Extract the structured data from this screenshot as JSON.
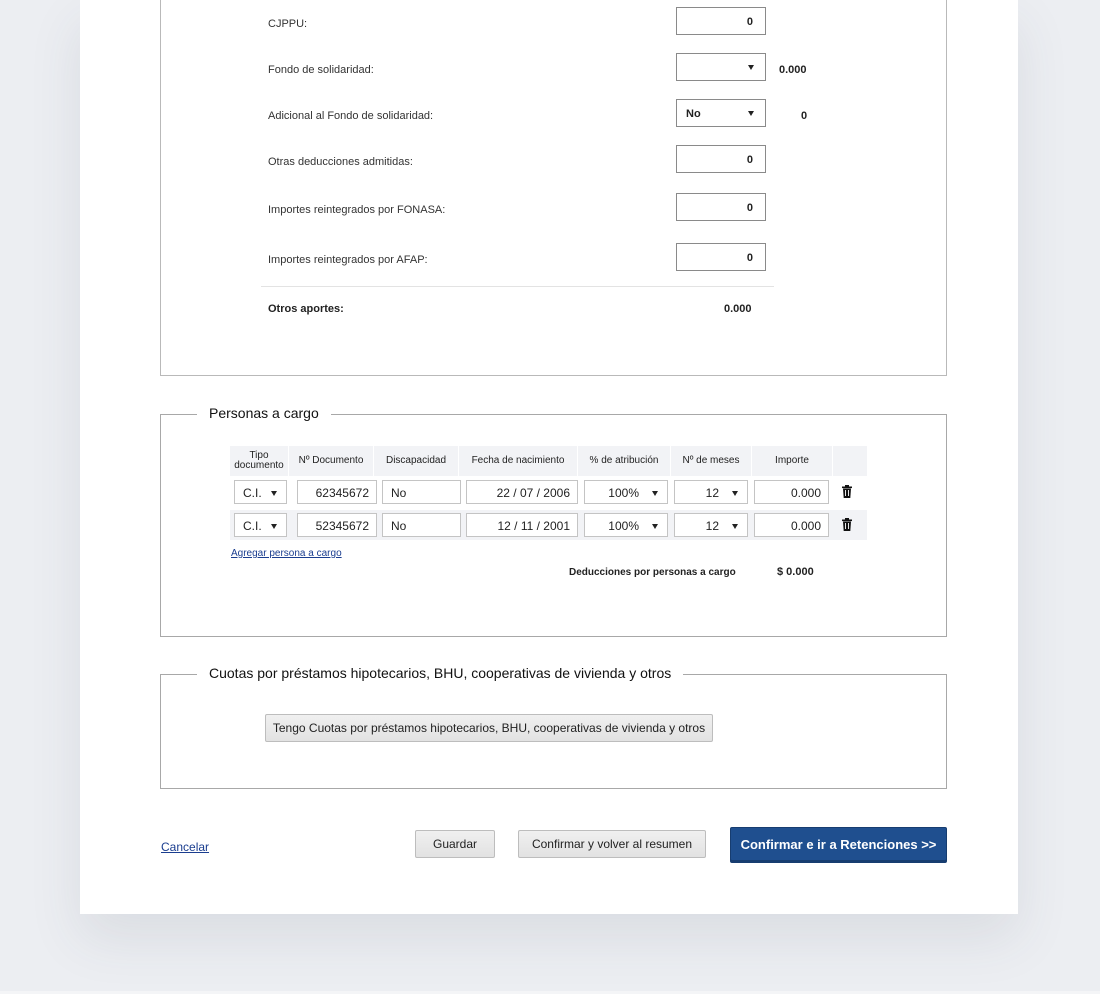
{
  "deductions": {
    "rows": [
      {
        "label": "CJPPU:",
        "value": "0"
      },
      {
        "label": "Fondo de solidaridad:",
        "select_value": "",
        "side_value": "0.000"
      },
      {
        "label": "Adicional al Fondo de solidaridad:",
        "select_value": "No",
        "side_value": "0"
      },
      {
        "label": "Otras deducciones admitidas:",
        "value": "0"
      },
      {
        "label": "Importes reintegrados por FONASA:",
        "value": "0"
      },
      {
        "label": "Importes reintegrados por AFAP:",
        "value": "0"
      }
    ],
    "total_label": "Otros aportes:",
    "total_value": "0.000"
  },
  "dependents": {
    "legend": "Personas a cargo",
    "headers": {
      "tipo": "Tipo documento",
      "tipo_l1": "Tipo",
      "tipo_l2": "documento",
      "documento": "Nº Documento",
      "discapacidad": "Discapacidad",
      "fecha": "Fecha de nacimiento",
      "atribucion": "% de atribución",
      "meses": "Nº de meses",
      "importe": "Importe"
    },
    "rows": [
      {
        "tipo": "C.I.",
        "documento": "62345672",
        "discapacidad": "No",
        "fecha": "22 / 07 / 2006",
        "atribucion": "100%",
        "meses": "12",
        "importe": "0.000"
      },
      {
        "tipo": "C.I.",
        "documento": "52345672",
        "discapacidad": "No",
        "fecha": "12 / 11 / 2001",
        "atribucion": "100%",
        "meses": "12",
        "importe": "0.000"
      }
    ],
    "add_link": "Agregar persona a cargo",
    "total_label": "Deducciones por personas a cargo",
    "total_value": "$ 0.000"
  },
  "mortgage": {
    "legend": "Cuotas por préstamos hipotecarios, BHU, cooperativas de vivienda y otros",
    "button_label": "Tengo Cuotas por préstamos hipotecarios, BHU, cooperativas de vivienda y otros"
  },
  "actions": {
    "cancel": "Cancelar",
    "save": "Guardar",
    "confirm_summary": "Confirmar y volver al resumen",
    "confirm_next": "Confirmar e ir a Retenciones >>"
  },
  "colors": {
    "primary": "#1f4f8f",
    "link": "#1a3d8f",
    "page_bg": "#eceef2",
    "table_header_bg": "#f2f3f6"
  }
}
